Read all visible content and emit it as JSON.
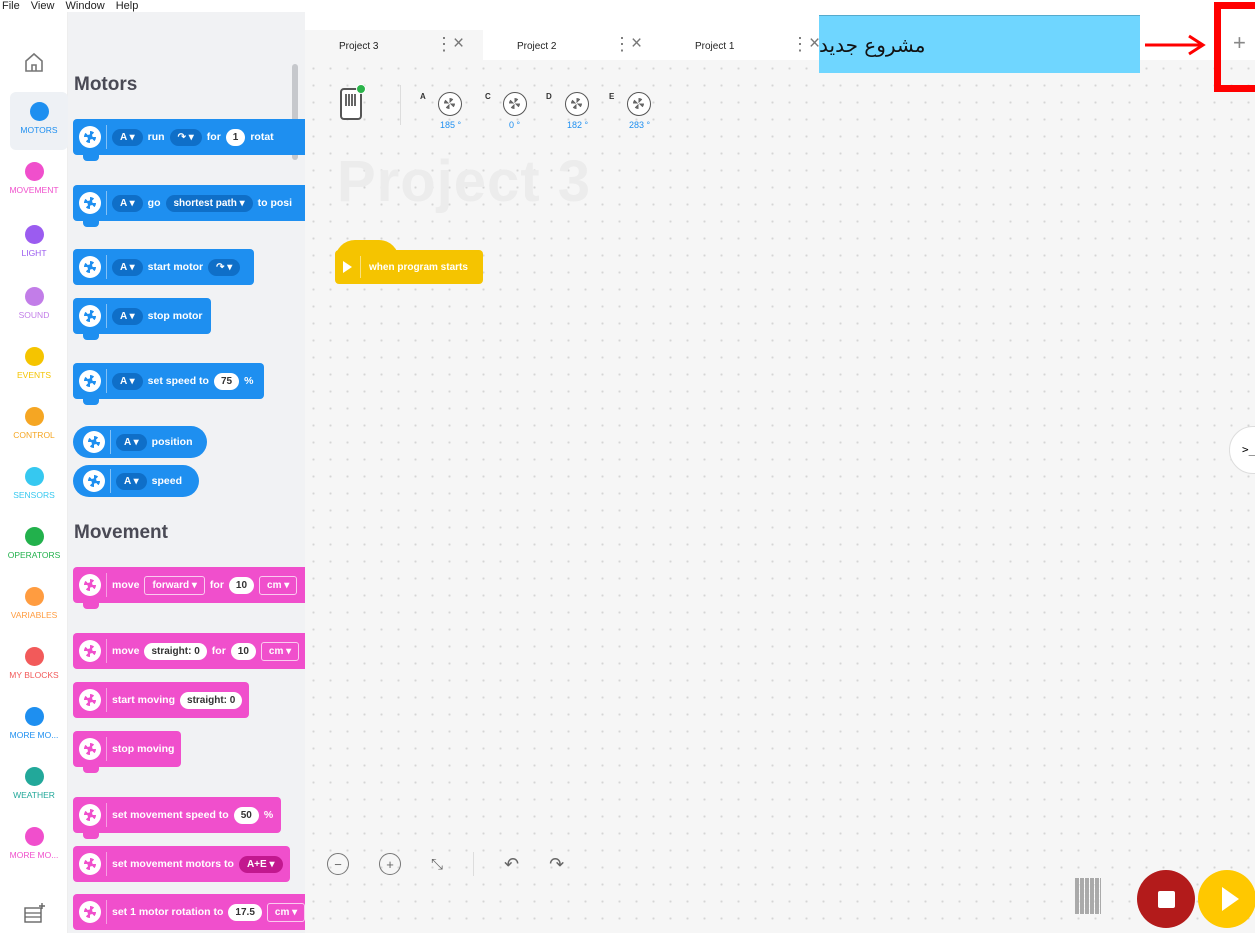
{
  "menubar": {
    "items": [
      "File",
      "View",
      "Window",
      "Help"
    ]
  },
  "categories": [
    {
      "label": "MOTORS",
      "color": "#1e8ff0"
    },
    {
      "label": "MOVEMENT",
      "color": "#f04fcc"
    },
    {
      "label": "LIGHT",
      "color": "#9b5cf0"
    },
    {
      "label": "SOUND",
      "color": "#c27de8"
    },
    {
      "label": "EVENTS",
      "color": "#f5c400"
    },
    {
      "label": "CONTROL",
      "color": "#f5a623"
    },
    {
      "label": "SENSORS",
      "color": "#36c8f0"
    },
    {
      "label": "OPERATORS",
      "color": "#22b14c"
    },
    {
      "label": "VARIABLES",
      "color": "#ff9c40"
    },
    {
      "label": "MY BLOCKS",
      "color": "#f25a5a"
    },
    {
      "label": "MORE MO...",
      "color": "#1e8ff0"
    },
    {
      "label": "WEATHER",
      "color": "#22a89a"
    },
    {
      "label": "MORE MO...",
      "color": "#f04fcc"
    }
  ],
  "palette": {
    "motors_heading": "Motors",
    "movement_heading": "Movement",
    "blocks": {
      "run": {
        "port": "A",
        "w1": "run",
        "w2": "for",
        "value": "1",
        "w3": "rotat"
      },
      "go": {
        "port": "A",
        "w1": "go",
        "dropdown": "shortest path",
        "w2": "to posi"
      },
      "start_motor": {
        "port": "A",
        "w1": "start motor"
      },
      "stop_motor": {
        "port": "A",
        "w1": "stop motor"
      },
      "set_speed": {
        "port": "A",
        "w1": "set speed to",
        "value": "75",
        "unit": "%"
      },
      "position": {
        "port": "A",
        "w1": "position"
      },
      "speed": {
        "port": "A",
        "w1": "speed"
      },
      "move_for": {
        "w1": "move",
        "dropdown": "forward",
        "w2": "for",
        "value": "10",
        "unit": "cm"
      },
      "move_straight": {
        "w1": "move",
        "pill": "straight: 0",
        "w2": "for",
        "value": "10",
        "unit": "cm"
      },
      "start_moving": {
        "w1": "start moving",
        "pill": "straight: 0"
      },
      "stop_moving": {
        "w1": "stop moving"
      },
      "set_move_speed": {
        "w1": "set movement speed to",
        "value": "50",
        "unit": "%"
      },
      "set_move_motors": {
        "w1": "set movement motors to",
        "dropdown": "A+E"
      },
      "set_rotation": {
        "w1": "set 1 motor rotation to",
        "value": "17.5",
        "unit": "cm"
      }
    }
  },
  "tabs": [
    {
      "label": "Project 3"
    },
    {
      "label": "Project 2"
    },
    {
      "label": "Project 1"
    }
  ],
  "hub": {
    "ports": [
      {
        "port": "A",
        "deg": "185 °"
      },
      {
        "port": "C",
        "deg": "0 °"
      },
      {
        "port": "D",
        "deg": "182 °"
      },
      {
        "port": "E",
        "deg": "283 °"
      }
    ]
  },
  "canvas": {
    "project_title": "Project 3",
    "hat_label": "when program starts"
  },
  "annotation": {
    "text": "مشروع جديد"
  },
  "colors": {
    "motors": "#1e8ff0",
    "movement": "#f04fcc",
    "events": "#f5c400",
    "stop": "#b31b1b",
    "run": "#ffc800",
    "annotation_bg": "#6fd6ff",
    "annotation_mark": "#ff0000"
  }
}
